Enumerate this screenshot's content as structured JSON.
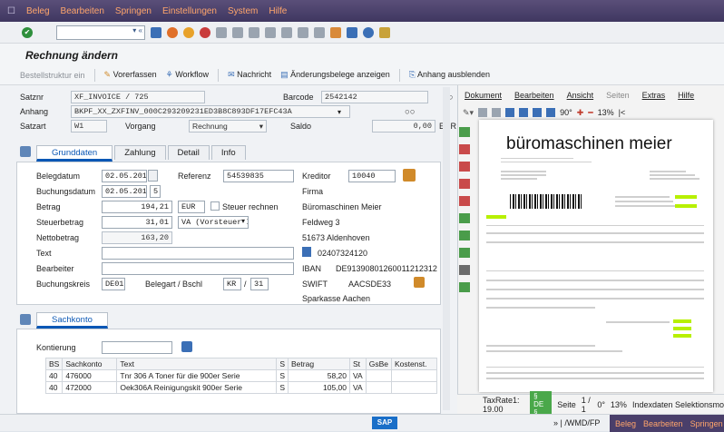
{
  "menu": {
    "items": [
      "Beleg",
      "Bearbeiten",
      "Springen",
      "Einstellungen",
      "System",
      "Hilfe"
    ]
  },
  "toolbar": {
    "command_value": "«"
  },
  "title": "Rechnung ändern",
  "appbar": {
    "bestell": "Bestellstruktur ein",
    "vorerfassen": "Vorerfassen",
    "workflow": "Workflow",
    "nachricht": "Nachricht",
    "aenderungsbelege": "Änderungsbelege anzeigen",
    "anhang": "Anhang ausblenden"
  },
  "header": {
    "satznr_label": "Satznr",
    "satznr": "XF_INVOICE / 725",
    "barcode_label": "Barcode",
    "barcode": "2542142",
    "anhang_label": "Anhang",
    "anhang": "BKPF_XX_ZXFINV_000C293209231ED3B8C893DF17EFC43A",
    "satzart_label": "Satzart",
    "satzart": "W1",
    "vorgang_label": "Vorgang",
    "vorgang": "Rechnung",
    "saldo_label": "Saldo",
    "saldo": "0,00",
    "currency": "EUR"
  },
  "tabs": [
    "Grunddaten",
    "Zahlung",
    "Detail",
    "Info"
  ],
  "grunddaten": {
    "belegdatum_label": "Belegdatum",
    "belegdatum": "02.05.2014",
    "referenz_label": "Referenz",
    "referenz": "54539835",
    "buchungsdatum_label": "Buchungsdatum",
    "buchungsdatum": "02.05.2014",
    "buchungsdatum_extra": "5",
    "betrag_label": "Betrag",
    "betrag": "194,21",
    "betrag_cur": "EUR",
    "steuer_label": "Steuer rechnen",
    "steuerbetrag_label": "Steuerbetrag",
    "steuerbetrag": "31,01",
    "steuerkz": "VA (Vorsteuer Inland 19...",
    "netto_label": "Nettobetrag",
    "netto": "163,20",
    "text_label": "Text",
    "bearbeiter_label": "Bearbeiter",
    "bukrs_label": "Buchungskreis",
    "bukrs": "DE01",
    "belegart_label": "Belegart / Bschl",
    "belegart": "KR",
    "bschl": "31",
    "kreditor_label": "Kreditor",
    "kreditor": "10040",
    "firma_label": "Firma",
    "name": "Büromaschinen Meier",
    "street": "Feldweg 3",
    "city": "51673 Aldenhoven",
    "phone": "02407324120",
    "iban_label": "IBAN",
    "iban": "DE91390801260011212312",
    "swift_label": "SWIFT",
    "swift": "AACSDE33",
    "bank": "Sparkasse Aachen"
  },
  "sachkonto": {
    "tab": "Sachkonto",
    "kontierung_label": "Kontierung",
    "columns": [
      "BS",
      "Sachkonto",
      "Text",
      "S",
      "Betrag",
      "St",
      "GsBe",
      "Kostenst."
    ],
    "rows": [
      [
        "40",
        "476000",
        "Tnr 306 A Toner für die 900er Serie",
        "S",
        "58,20",
        "VA",
        "",
        ""
      ],
      [
        "40",
        "472000",
        "Oek306A Reinigungskit 900er Serie",
        "S",
        "105,00",
        "VA",
        "",
        ""
      ]
    ]
  },
  "viewer": {
    "menu": [
      "Dokument",
      "Bearbeiten",
      "Ansicht",
      "Seiten",
      "Extras",
      "Hilfe"
    ],
    "zoom_angle": "90°",
    "zoom": "13%",
    "doc_logo": "büromaschinen meier",
    "status_tax": "TaxRate1: 19.00",
    "status_page": "Seite",
    "status_pages": "1 / 1",
    "status_rot": "0°",
    "status_zoom": "13%",
    "status_index": "Indexdaten Selektionsmo",
    "status_badge": "§ DE §"
  },
  "statusbar": {
    "text": "» | /WMD/FP"
  }
}
